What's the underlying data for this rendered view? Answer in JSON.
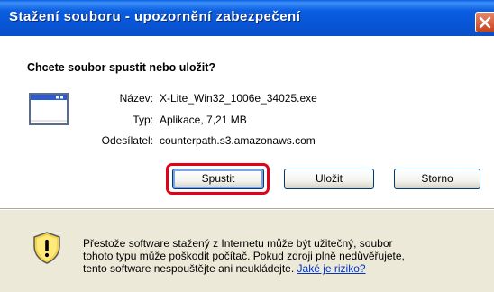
{
  "window": {
    "title": "Stažení souboru - upozornění zabezpečení",
    "close_icon": "close-icon"
  },
  "dialog": {
    "question": "Chcete soubor spustit nebo uložit?",
    "file_icon": "application-window-icon",
    "info": {
      "name_label": "Název:",
      "name_value": "X-Lite_Win32_1006e_34025.exe",
      "type_label": "Typ:",
      "type_value": "Aplikace, 7,21 MB",
      "sender_label": "Odesílatel:",
      "sender_value": "counterpath.s3.amazonaws.com"
    },
    "buttons": {
      "run": "Spustit",
      "save": "Uložit",
      "cancel": "Storno"
    },
    "highlight_color": "#e2001a"
  },
  "warning": {
    "icon": "security-shield-warning-icon",
    "line1": "Přestože software stažený z Internetu může být užitečný, soubor",
    "line2": "tohoto typu může poškodit počítač. Pokud zdroji plně nedůvěřujete,",
    "line3": "tento software nespouštějte ani neukládejte.",
    "link": "Jaké je riziko?"
  }
}
